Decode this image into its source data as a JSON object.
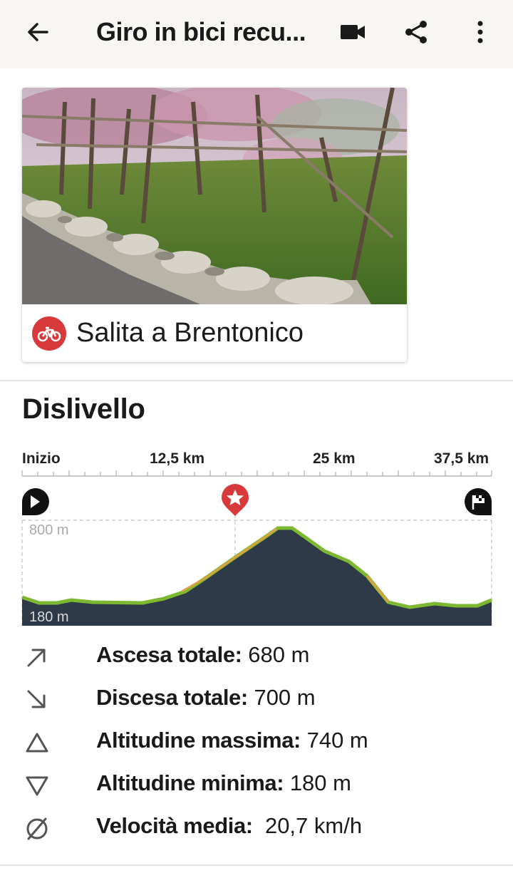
{
  "header": {
    "title": "Giro in bici recu...",
    "back_icon": "arrow-left-icon",
    "video_icon": "video-camera-icon",
    "share_icon": "share-icon",
    "menu_icon": "more-vertical-icon"
  },
  "tour_card": {
    "name": "Salita a Brentonico",
    "sport_icon": "bicycle-icon",
    "badge_color": "#d8393a"
  },
  "elevation": {
    "title": "Dislivello",
    "km_labels": [
      "Inizio",
      "12,5 km",
      "25 km",
      "37,5 km"
    ],
    "max_label": "800 m",
    "min_label": "180 m",
    "markers": [
      "start-flag-icon",
      "highlight-star-icon",
      "finish-flag-icon"
    ],
    "profile_color": "#2e3a48",
    "line_color": "#7cb830"
  },
  "stats": [
    {
      "icon": "arrow-up-right-icon",
      "label": "Ascesa totale:",
      "value": "680 m"
    },
    {
      "icon": "arrow-down-right-icon",
      "label": "Discesa totale:",
      "value": "700 m"
    },
    {
      "icon": "triangle-up-icon",
      "label": "Altitudine massima:",
      "value": "740 m"
    },
    {
      "icon": "triangle-down-icon",
      "label": "Altitudine minima:",
      "value": "180 m"
    },
    {
      "icon": "average-icon",
      "label": "Velocità media:",
      "value": "20,7 km/h"
    }
  ]
}
